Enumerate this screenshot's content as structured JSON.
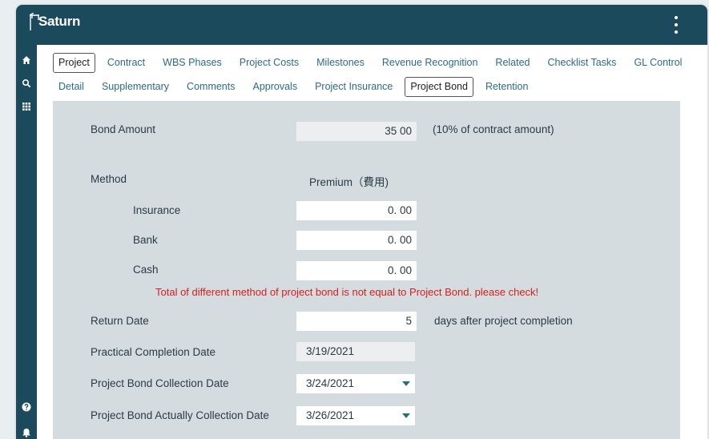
{
  "app": {
    "name": "Saturn"
  },
  "tabs_row1": [
    {
      "label": "Project",
      "active": true
    },
    {
      "label": "Contract"
    },
    {
      "label": "WBS Phases"
    },
    {
      "label": "Project Costs"
    },
    {
      "label": "Milestones"
    },
    {
      "label": "Revenue Recognition"
    },
    {
      "label": "Related"
    },
    {
      "label": "Checklist Tasks"
    },
    {
      "label": "GL Control"
    }
  ],
  "tabs_row2": [
    {
      "label": "Detail"
    },
    {
      "label": "Supplementary"
    },
    {
      "label": "Comments"
    },
    {
      "label": "Approvals"
    },
    {
      "label": "Project Insurance"
    },
    {
      "label": "Project Bond",
      "active": true
    },
    {
      "label": "Retention"
    }
  ],
  "form": {
    "bond_amount_label": "Bond Amount",
    "bond_amount_value": "35 00",
    "bond_amount_note": "(10% of contract amount)",
    "method_label": "Method",
    "premium_header": "Premium（費用)",
    "insurance_label": "Insurance",
    "insurance_value": "0. 00",
    "bank_label": "Bank",
    "bank_value": "0. 00",
    "cash_label": "Cash",
    "cash_value": "0. 00",
    "error_message": "Total of different method of project bond is not equal to Project Bond. please check!",
    "return_date_label": "Return Date",
    "return_date_value": "5",
    "return_date_suffix": "days after project completion",
    "practical_completion_label": "Practical Completion Date",
    "practical_completion_value": "3/19/2021",
    "collection_date_label": "Project Bond Collection Date",
    "collection_date_value": "3/24/2021",
    "actual_collection_label": "Project Bond Actually Collection Date",
    "actual_collection_value": "3/26/2021"
  },
  "colors": {
    "topbar": "#1a4a5c",
    "tab_link": "#2e6b88",
    "panel": "#d5dcdf",
    "error": "#d42020"
  },
  "icons": [
    "home-icon",
    "search-icon",
    "grid-icon",
    "help-icon",
    "bell-icon",
    "kebab-menu-icon"
  ]
}
